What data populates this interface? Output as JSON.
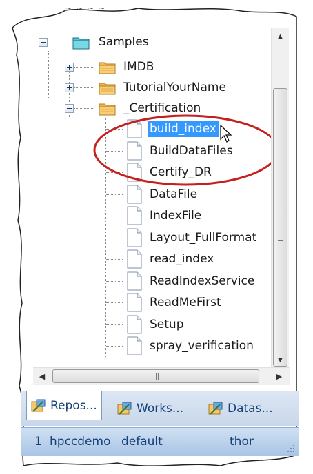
{
  "tree": {
    "root": {
      "label": "Samples",
      "icon": "folder-cyan-icon"
    },
    "folders": [
      {
        "label": "IMDB",
        "icon": "folder-icon",
        "expander": "plus"
      },
      {
        "label": "TutorialYourName",
        "icon": "folder-icon",
        "expander": "plus"
      },
      {
        "label": "_Certification",
        "icon": "folder-icon",
        "expander": "minus"
      }
    ],
    "files": [
      {
        "label": "build_index",
        "selected": true
      },
      {
        "label": "BuildDataFiles"
      },
      {
        "label": "Certify_DR"
      },
      {
        "label": "DataFile"
      },
      {
        "label": "IndexFile"
      },
      {
        "label": "Layout_FullFormat"
      },
      {
        "label": "read_index"
      },
      {
        "label": "ReadIndexService"
      },
      {
        "label": "ReadMeFirst"
      },
      {
        "label": "Setup"
      },
      {
        "label": "spray_verification"
      }
    ]
  },
  "tabs": [
    {
      "label": "Repos...",
      "icon": "repository-icon",
      "active": true
    },
    {
      "label": "Works...",
      "icon": "workunits-icon",
      "active": false
    },
    {
      "label": "Datas...",
      "icon": "datasets-icon",
      "active": false
    }
  ],
  "status": {
    "count": "1",
    "server": "hpccdemo",
    "cluster": "default",
    "target": "thor"
  },
  "colors": {
    "selection": "#3399ff",
    "annotation_circle": "#c42020",
    "folder": "#f5c66a",
    "tab_text": "#15407a"
  }
}
